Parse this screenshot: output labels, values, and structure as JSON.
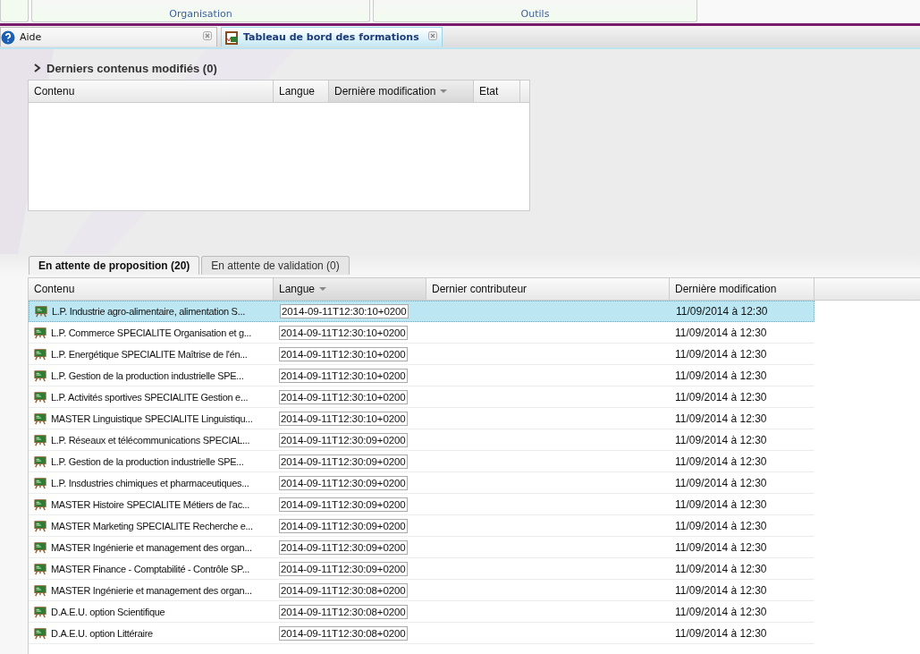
{
  "ribbon": {
    "groups": [
      {
        "label": "Organisation"
      },
      {
        "label": "Outils"
      }
    ]
  },
  "tabs": [
    {
      "label": "Aide",
      "kind": "help",
      "selected": false
    },
    {
      "label": "Tableau de bord des formations",
      "kind": "dashboard",
      "selected": true
    }
  ],
  "recent_panel": {
    "title": "Derniers contenus modifiés (0)",
    "expanded": false,
    "columns": [
      {
        "label": "Contenu",
        "sorted": false
      },
      {
        "label": "Langue",
        "sorted": false
      },
      {
        "label": "Dernière modification",
        "sorted": true
      },
      {
        "label": "Etat",
        "sorted": false
      }
    ]
  },
  "pending_tabs": [
    {
      "label": "En attente de proposition (20)",
      "selected": true
    },
    {
      "label": "En attente de validation (0)",
      "selected": false
    }
  ],
  "table": {
    "columns": [
      {
        "label": "Contenu",
        "sorted": false
      },
      {
        "label": "Langue",
        "sorted": true
      },
      {
        "label": "Dernier contributeur",
        "sorted": false
      },
      {
        "label": "Dernière modification",
        "sorted": false
      }
    ],
    "rows": [
      {
        "content": "L.P. Industrie agro-alimentaire, alimentation S...",
        "language": "2014-09-11T12:30:10+0200",
        "modified": "11/09/2014 à 12:30",
        "selected": true
      },
      {
        "content": "L.P. Commerce SPECIALITE Organisation et g...",
        "language": "2014-09-11T12:30:10+0200",
        "modified": "11/09/2014 à 12:30",
        "selected": false
      },
      {
        "content": "L.P. Energétique SPECIALITE Maîtrise de l'én...",
        "language": "2014-09-11T12:30:10+0200",
        "modified": "11/09/2014 à 12:30",
        "selected": false
      },
      {
        "content": "L.P. Gestion de la production industrielle SPE...",
        "language": "2014-09-11T12:30:10+0200",
        "modified": "11/09/2014 à 12:30",
        "selected": false
      },
      {
        "content": "L.P. Activités sportives SPECIALITE Gestion e...",
        "language": "2014-09-11T12:30:10+0200",
        "modified": "11/09/2014 à 12:30",
        "selected": false
      },
      {
        "content": "MASTER Linguistique SPECIALITE Linguistiqu...",
        "language": "2014-09-11T12:30:10+0200",
        "modified": "11/09/2014 à 12:30",
        "selected": false
      },
      {
        "content": "L.P. Réseaux et télécommunications SPECIAL...",
        "language": "2014-09-11T12:30:09+0200",
        "modified": "11/09/2014 à 12:30",
        "selected": false
      },
      {
        "content": "L.P. Gestion de la production industrielle SPE...",
        "language": "2014-09-11T12:30:09+0200",
        "modified": "11/09/2014 à 12:30",
        "selected": false
      },
      {
        "content": "L.P. Insdustries chimiques et pharmaceutiques...",
        "language": "2014-09-11T12:30:09+0200",
        "modified": "11/09/2014 à 12:30",
        "selected": false
      },
      {
        "content": "MASTER Histoire SPECIALITE Métiers de l'ac...",
        "language": "2014-09-11T12:30:09+0200",
        "modified": "11/09/2014 à 12:30",
        "selected": false
      },
      {
        "content": "MASTER Marketing SPECIALITE Recherche e...",
        "language": "2014-09-11T12:30:09+0200",
        "modified": "11/09/2014 à 12:30",
        "selected": false
      },
      {
        "content": "MASTER Ingénierie et management des organ...",
        "language": "2014-09-11T12:30:09+0200",
        "modified": "11/09/2014 à 12:30",
        "selected": false
      },
      {
        "content": "MASTER Finance - Comptabilité - Contrôle SP...",
        "language": "2014-09-11T12:30:09+0200",
        "modified": "11/09/2014 à 12:30",
        "selected": false
      },
      {
        "content": "MASTER Ingénierie et management des organ...",
        "language": "2014-09-11T12:30:08+0200",
        "modified": "11/09/2014 à 12:30",
        "selected": false
      },
      {
        "content": "D.A.E.U. option Scientifique",
        "language": "2014-09-11T12:30:08+0200",
        "modified": "11/09/2014 à 12:30",
        "selected": false
      },
      {
        "content": "D.A.E.U. option Littéraire",
        "language": "2014-09-11T12:30:08+0200",
        "modified": "11/09/2014 à 12:30",
        "selected": false
      }
    ]
  }
}
